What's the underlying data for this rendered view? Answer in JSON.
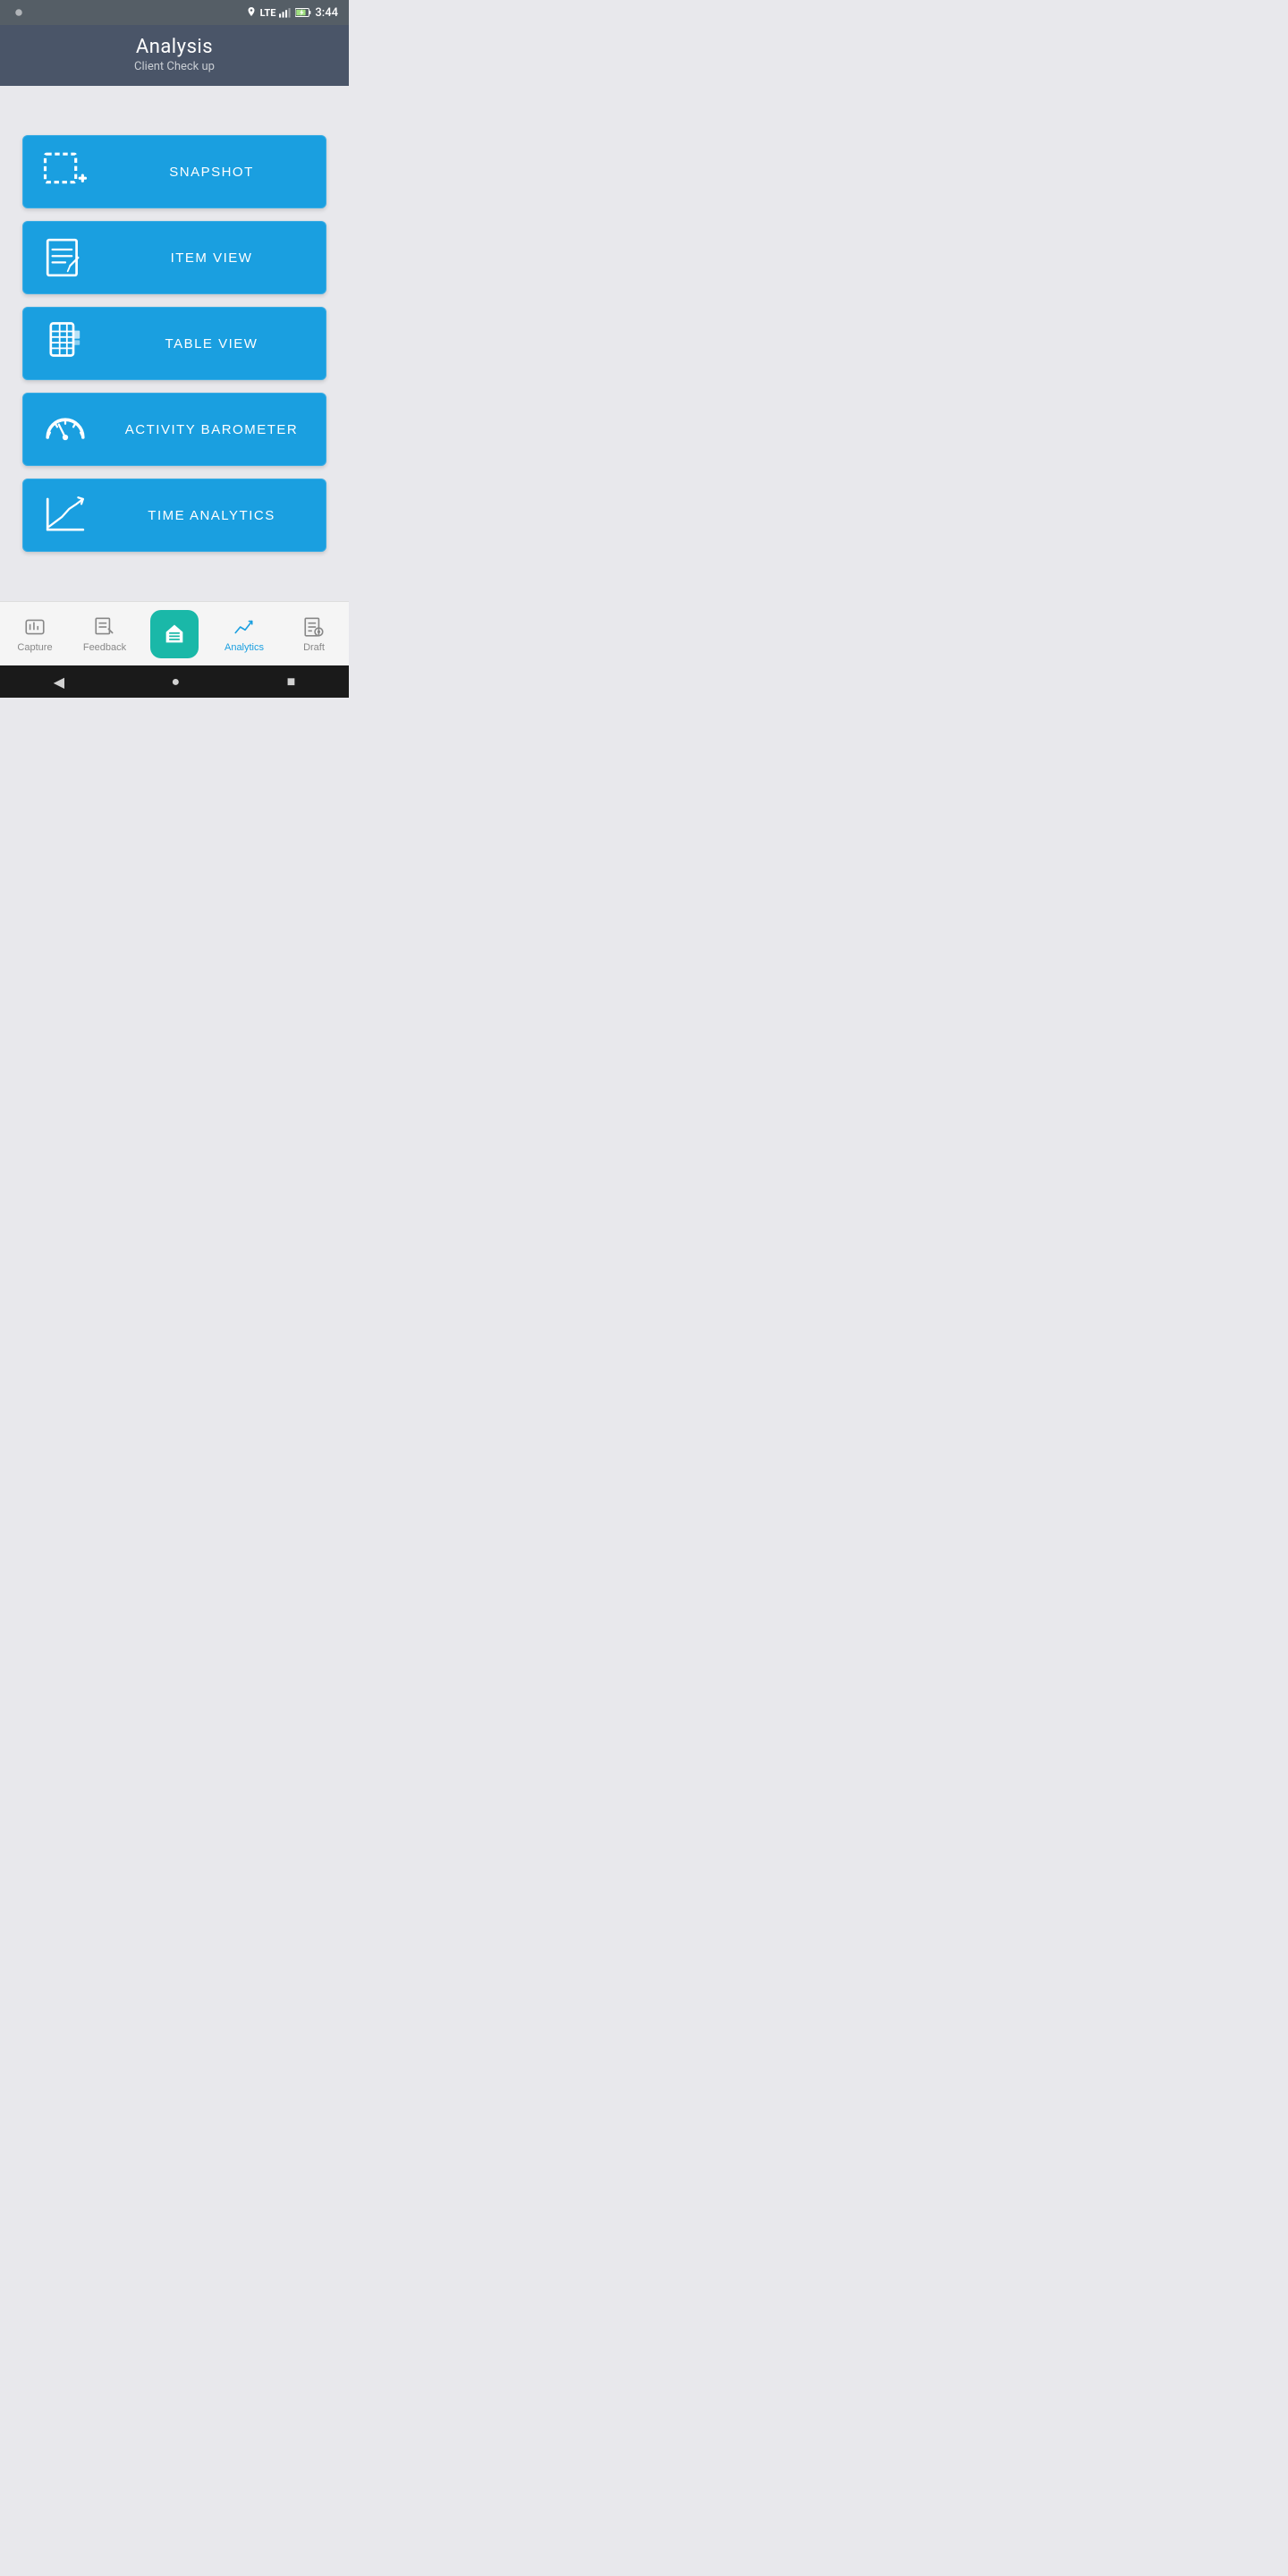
{
  "statusBar": {
    "time": "3:44"
  },
  "header": {
    "title": "Analysis",
    "subtitle": "Client Check up"
  },
  "buttons": [
    {
      "id": "snapshot",
      "label": "SNAPSHOT",
      "icon": "snapshot"
    },
    {
      "id": "item-view",
      "label": "ITEM VIEW",
      "icon": "item-view"
    },
    {
      "id": "table-view",
      "label": "TABLE VIEW",
      "icon": "table-view"
    },
    {
      "id": "activity-barometer",
      "label": "ACTIVITY BAROMETER",
      "icon": "barometer"
    },
    {
      "id": "time-analytics",
      "label": "TIME ANALYTICS",
      "icon": "time-analytics"
    }
  ],
  "bottomNav": {
    "items": [
      {
        "id": "capture",
        "label": "Capture",
        "active": false
      },
      {
        "id": "feedback",
        "label": "Feedback",
        "active": false
      },
      {
        "id": "home",
        "label": "",
        "active": false,
        "center": true
      },
      {
        "id": "analytics",
        "label": "Analytics",
        "active": true
      },
      {
        "id": "draft",
        "label": "Draft",
        "active": false
      }
    ]
  }
}
